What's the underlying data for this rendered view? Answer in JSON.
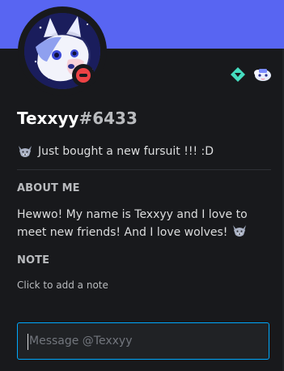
{
  "profile": {
    "username": "Texxyy",
    "discriminator": "#6433",
    "status": "do-not-disturb",
    "custom_status_icon": "wolf-emoji",
    "custom_status_text": "Just bought a new fursuit !!! :D"
  },
  "badges": [
    {
      "name": "hypesquad-balance-icon"
    },
    {
      "name": "early-supporter-icon"
    }
  ],
  "about": {
    "title": "ABOUT ME",
    "text": "Hewwo! My name is Texxyy and I love to meet new friends! And I love wolves!",
    "trailing_icon": "wolf-emoji"
  },
  "note": {
    "title": "NOTE",
    "placeholder": "Click to add a note"
  },
  "message": {
    "placeholder": "Message @Texxyy"
  },
  "colors": {
    "banner": "#5865f2",
    "background": "#18191c",
    "dnd": "#ed4245",
    "focus_border": "#00a8fc"
  }
}
